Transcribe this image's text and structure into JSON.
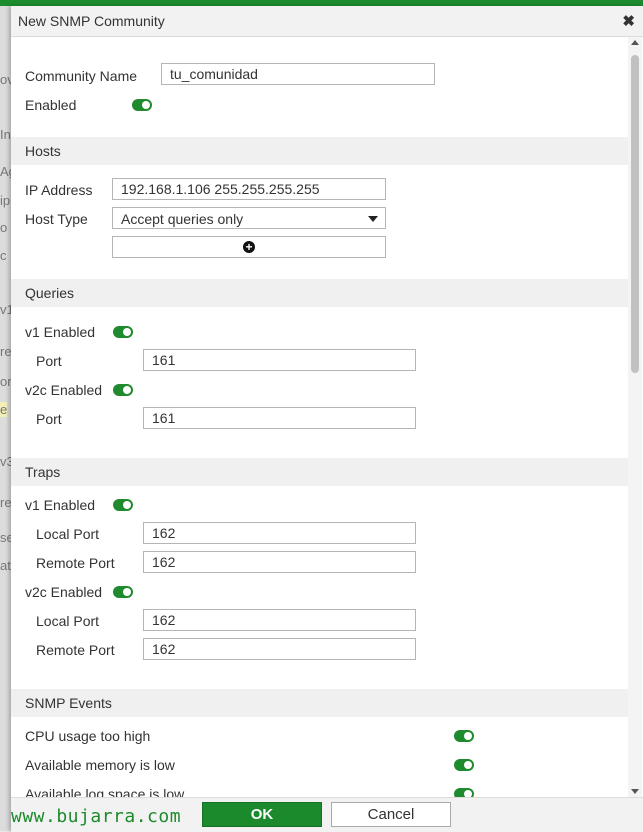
{
  "dialog": {
    "title": "New SNMP Community",
    "close_glyph": "✖"
  },
  "general": {
    "community_name_label": "Community Name",
    "community_name_value": "tu_comunidad",
    "enabled_label": "Enabled",
    "enabled": true
  },
  "hosts": {
    "section_title": "Hosts",
    "ip_label": "IP Address",
    "ip_value": "192.168.1.106 255.255.255.255",
    "host_type_label": "Host Type",
    "host_type_value": "Accept queries only",
    "add_glyph": "+"
  },
  "queries": {
    "section_title": "Queries",
    "v1_label": "v1 Enabled",
    "v1_enabled": true,
    "v1_port_label": "Port",
    "v1_port_value": "161",
    "v2c_label": "v2c Enabled",
    "v2c_enabled": true,
    "v2c_port_label": "Port",
    "v2c_port_value": "161"
  },
  "traps": {
    "section_title": "Traps",
    "v1_label": "v1 Enabled",
    "v1_enabled": true,
    "v1_local_port_label": "Local Port",
    "v1_local_port_value": "162",
    "v1_remote_port_label": "Remote Port",
    "v1_remote_port_value": "162",
    "v2c_label": "v2c Enabled",
    "v2c_enabled": true,
    "v2c_local_port_label": "Local Port",
    "v2c_local_port_value": "162",
    "v2c_remote_port_label": "Remote Port",
    "v2c_remote_port_value": "162"
  },
  "snmp_events": {
    "section_title": "SNMP Events",
    "items": [
      {
        "label": "CPU usage too high",
        "enabled": true
      },
      {
        "label": "Available memory is low",
        "enabled": true
      },
      {
        "label": "Available log space is low",
        "enabled": true
      }
    ]
  },
  "footer": {
    "watermark": "www.bujarra.com",
    "ok_label": "OK",
    "cancel_label": "Cancel"
  },
  "background_fragments": [
    "ov",
    "In",
    "Ag",
    "ip",
    "o",
    "c",
    "v1",
    "re",
    "or",
    "e",
    "v3",
    "re",
    "se",
    "at"
  ],
  "colors": {
    "accent_green": "#1f8a2e",
    "top_bar": "#1c8c2e",
    "section_bg": "#f0f0f0"
  }
}
